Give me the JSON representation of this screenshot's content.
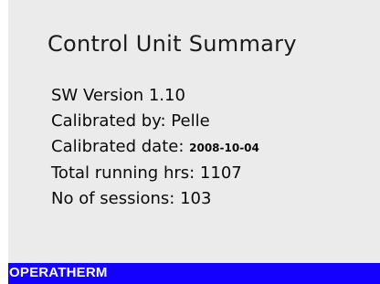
{
  "screen": {
    "title": "Control Unit Summary",
    "sw_version": "SW Version 1.10",
    "calibrated_by": "Calibrated by: Pelle",
    "calibrated_date_label": "Calibrated date:",
    "calibrated_date_value": "2008-10-04",
    "total_running_hrs": "Total running hrs: 1107",
    "sessions": "No of sessions: 103"
  },
  "status_bar": {
    "brand": "OPERATHERM"
  },
  "colors": {
    "panel_background": "#ebebeb",
    "status_bar": "#1400ff",
    "text": "#0a0a0a",
    "brand_text": "#ffffff"
  }
}
